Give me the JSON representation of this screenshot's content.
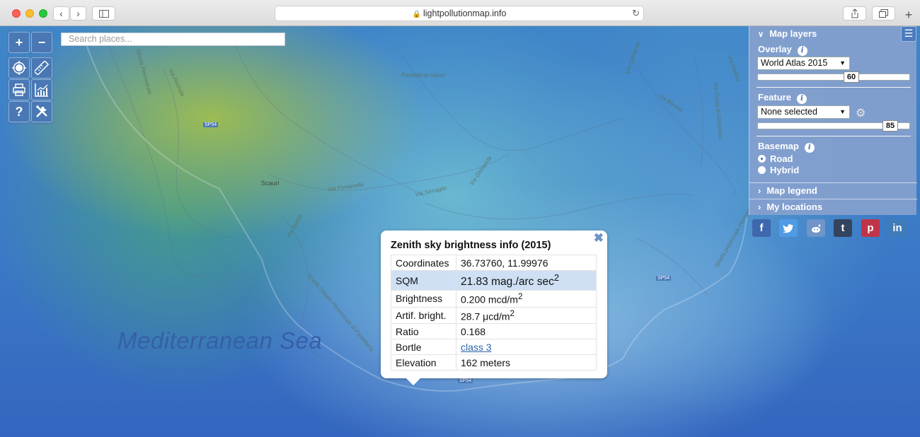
{
  "browser": {
    "url": "lightpollutionmap.info"
  },
  "map": {
    "search_placeholder": "Search places...",
    "labels": {
      "sea": "Mediterranean Sea",
      "island": "Pantelleria Island",
      "town": "Scauri",
      "roads": [
        "SP54",
        "SP54",
        "SP54"
      ]
    }
  },
  "controls": {
    "zoom_in": "+",
    "zoom_out": "−",
    "help": "?"
  },
  "panel": {
    "title": "Map layers",
    "overlay_label": "Overlay",
    "overlay_value": "World Atlas 2015",
    "overlay_opacity": "60",
    "feature_label": "Feature",
    "feature_value": "None selected",
    "feature_opacity": "85",
    "basemap_label": "Basemap",
    "basemap_options": [
      "Road",
      "Hybrid"
    ],
    "basemap_selected": "Road",
    "map_legend": "Map legend",
    "my_locations": "My locations"
  },
  "social": [
    {
      "name": "facebook",
      "glyph": "f",
      "color": "#3f67ad"
    },
    {
      "name": "twitter",
      "glyph": "t",
      "color": "#4f9be5"
    },
    {
      "name": "reddit",
      "glyph": "r",
      "color": "#6f95c9"
    },
    {
      "name": "tumblr",
      "glyph": "t",
      "color": "#33445e"
    },
    {
      "name": "pinterest",
      "glyph": "p",
      "color": "#c0344a"
    },
    {
      "name": "linkedin",
      "glyph": "in",
      "color": "#3f7cb8"
    }
  ],
  "popup": {
    "title": "Zenith sky brightness info (2015)",
    "rows": [
      {
        "key": "Coordinates",
        "value": "36.73760, 11.99976"
      },
      {
        "key": "SQM",
        "value": "21.83 mag./arc sec",
        "sup": "2"
      },
      {
        "key": "Brightness",
        "value": "0.200 mcd/m",
        "sup": "2"
      },
      {
        "key": "Artif. bright.",
        "value": "28.7 μcd/m",
        "sup": "2"
      },
      {
        "key": "Ratio",
        "value": "0.168"
      },
      {
        "key": "Bortle",
        "value": "class 3"
      },
      {
        "key": "Elevation",
        "value": "162 meters"
      }
    ]
  }
}
